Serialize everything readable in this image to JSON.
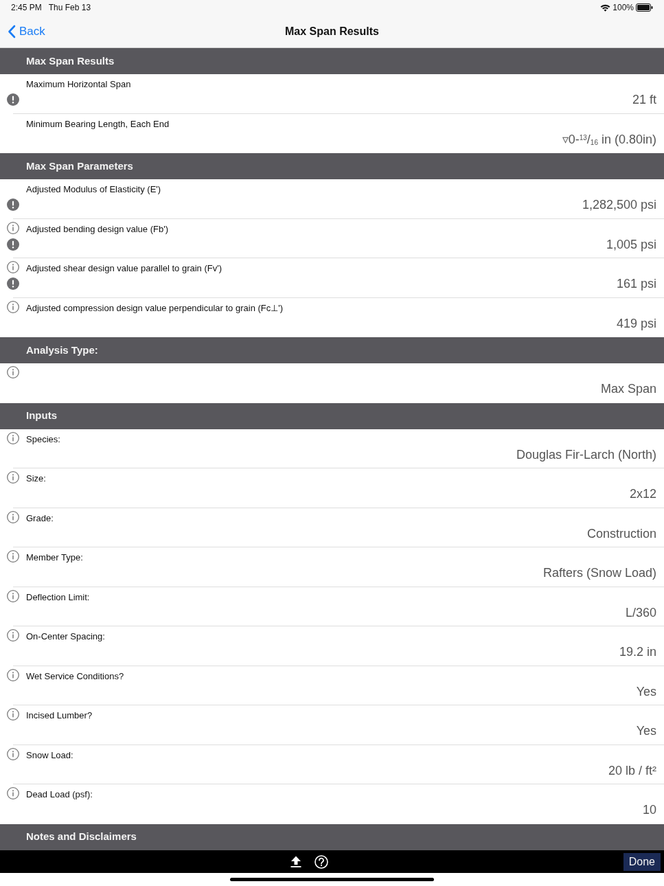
{
  "status_bar": {
    "time": "2:45 PM",
    "date": "Thu Feb 13",
    "battery": "100%"
  },
  "nav_bar": {
    "back": "Back",
    "title": "Max Span Results"
  },
  "sections": [
    {
      "title": "Max Span Results",
      "rows": [
        {
          "label": "Maximum Horizontal Span",
          "value": "21 ft",
          "info": false,
          "warning": true
        },
        {
          "label": "Minimum Bearing Length, Each End",
          "value": "▿0-$^{13}$/$_{16}$ in (0.80in)",
          "info": false,
          "warning": false
        }
      ]
    },
    {
      "title": "Max Span Parameters",
      "rows": [
        {
          "label": "Adjusted Modulus of Elasticity (E')",
          "value": "1,282,500 psi",
          "info": false,
          "warning": true
        },
        {
          "label": "Adjusted bending design value (Fb')",
          "value": "1,005 psi",
          "info": true,
          "warning": true
        },
        {
          "label": "Adjusted shear design value parallel to grain (Fv')",
          "value": "161 psi",
          "info": true,
          "warning": true
        },
        {
          "label": "Adjusted compression design value perpendicular to grain (Fc⊥')",
          "value": "419 psi",
          "info": true,
          "warning": false
        }
      ]
    },
    {
      "title": "Analysis Type:",
      "rows": [
        {
          "value": "Max Span",
          "info": true,
          "warning": false
        }
      ]
    },
    {
      "title": "Inputs",
      "rows": [
        {
          "label": "Species:",
          "value": "Douglas Fir-Larch (North)",
          "info": true,
          "warning": false
        },
        {
          "label": "Size:",
          "value": "2x12",
          "info": true,
          "warning": false
        },
        {
          "label": "Grade:",
          "value": "Construction",
          "info": true,
          "warning": false
        },
        {
          "label": "Member Type:",
          "value": "Rafters (Snow Load)",
          "info": true,
          "warning": false
        },
        {
          "label": "Deflection Limit:",
          "value": "L/360",
          "info": true,
          "warning": false
        },
        {
          "label": "On-Center Spacing:",
          "value": "19.2 in",
          "info": true,
          "warning": false
        },
        {
          "label": "Wet Service Conditions?",
          "value": "Yes",
          "info": true,
          "warning": false
        },
        {
          "label": "Incised Lumber?",
          "value": "Yes",
          "info": true,
          "warning": false
        },
        {
          "label": "Snow Load:",
          "value": "20 lb / ft²",
          "info": true,
          "warning": false
        },
        {
          "label": "Dead Load (psf):",
          "value": "10",
          "info": true,
          "warning": false
        }
      ]
    },
    {
      "title": "Notes and Disclaimers"
    }
  ],
  "toolbar": {
    "done": "Done"
  }
}
